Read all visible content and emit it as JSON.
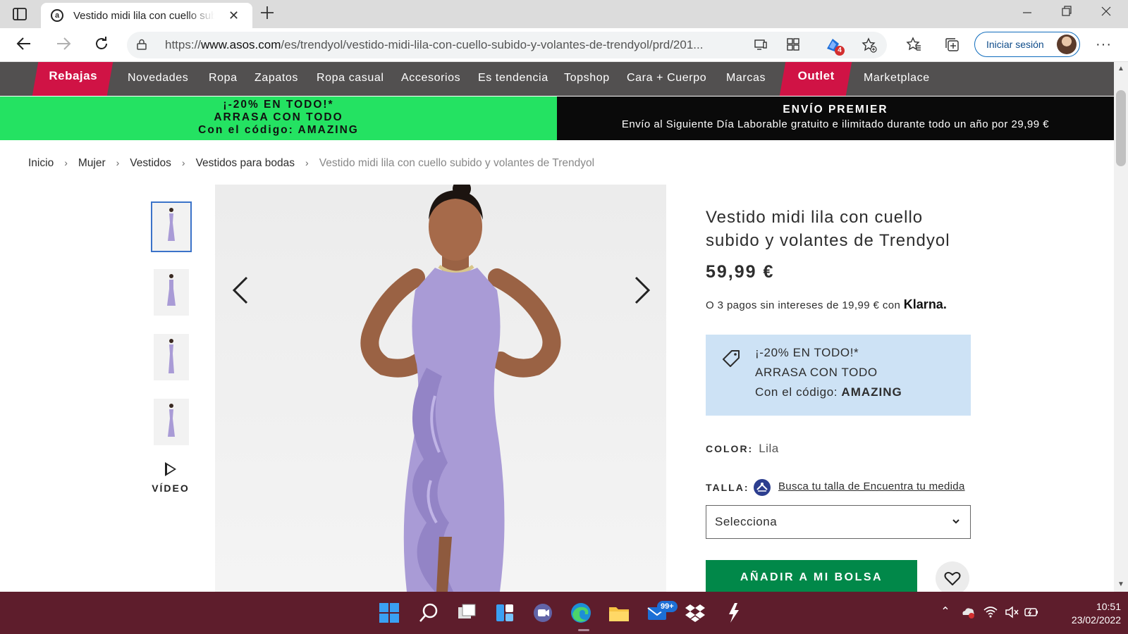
{
  "browser": {
    "tab": {
      "title": "Vestido midi lila con cuello subido y volantes de Trendyol"
    },
    "url": {
      "scheme": "https://",
      "domain": "www.asos.com",
      "path": "/es/trendyol/vestido-midi-lila-con-cuello-subido-y-volantes-de-trendyol/prd/201..."
    },
    "extension_badge": "4",
    "signin_label": "Iniciar sesión",
    "icons": [
      "tab-actions-icon",
      "close-icon",
      "plus-icon",
      "minimize-icon",
      "restore-icon",
      "back-icon",
      "forward-icon",
      "reload-icon",
      "lock-icon",
      "reader-icon",
      "apps-icon",
      "extension-icon",
      "add-favorite-icon",
      "favorites-icon",
      "collections-icon",
      "more-icon"
    ]
  },
  "site_nav": {
    "items": [
      "Rebajas",
      "Novedades",
      "Ropa",
      "Zapatos",
      "Ropa casual",
      "Accesorios",
      "Es tendencia",
      "Topshop",
      "Cara + Cuerpo",
      "Marcas",
      "Outlet",
      "Marketplace"
    ],
    "sale_color": "#d01345",
    "bg_color": "#525050"
  },
  "promo_banner": {
    "line1": "¡-20% EN TODO!*",
    "line2": "ARRASA CON TODO",
    "line3": "Con el código: AMAZING",
    "color": "#24e262"
  },
  "premier_banner": {
    "title": "ENVÍO PREMIER",
    "subtitle": "Envío al Siguiente Día Laborable gratuito e ilimitado durante todo un año por 29,99 €"
  },
  "breadcrumb": {
    "items": [
      "Inicio",
      "Mujer",
      "Vestidos",
      "Vestidos para bodas"
    ],
    "current": "Vestido midi lila con cuello subido y volantes de Trendyol",
    "separator": "›"
  },
  "gallery": {
    "video_label": "VÍDEO",
    "dress_color": "#a99bd6"
  },
  "product": {
    "title": "Vestido midi lila con cuello subido y volantes de Trendyol",
    "price": "59,99 €",
    "installments": "O 3 pagos sin intereses de 19,99 € con",
    "installments_provider": "Klarna.",
    "promo": {
      "line1": "¡-20% EN TODO!*",
      "line2": "ARRASA CON TODO",
      "line3_prefix": "Con el código:",
      "code": "AMAZING",
      "color": "#cde2f5"
    },
    "color_label": "COLOR:",
    "color_value": "Lila",
    "size_label": "TALLA:",
    "size_link": "Busca tu talla de Encuentra tu medida",
    "size_select": "Selecciona",
    "add_to_bag": "AÑADIR A MI BOLSA",
    "add_to_bag_color": "#018849"
  },
  "taskbar": {
    "apps": [
      "windows-start-icon",
      "search-icon",
      "task-view-icon",
      "widgets-icon",
      "teams-chat-icon",
      "edge-icon",
      "file-explorer-icon",
      "mail-icon",
      "dropbox-icon",
      "app-icon"
    ],
    "mail_badge": "99+",
    "time": "10:51",
    "date": "23/02/2022",
    "color": "#5e1d2c"
  }
}
